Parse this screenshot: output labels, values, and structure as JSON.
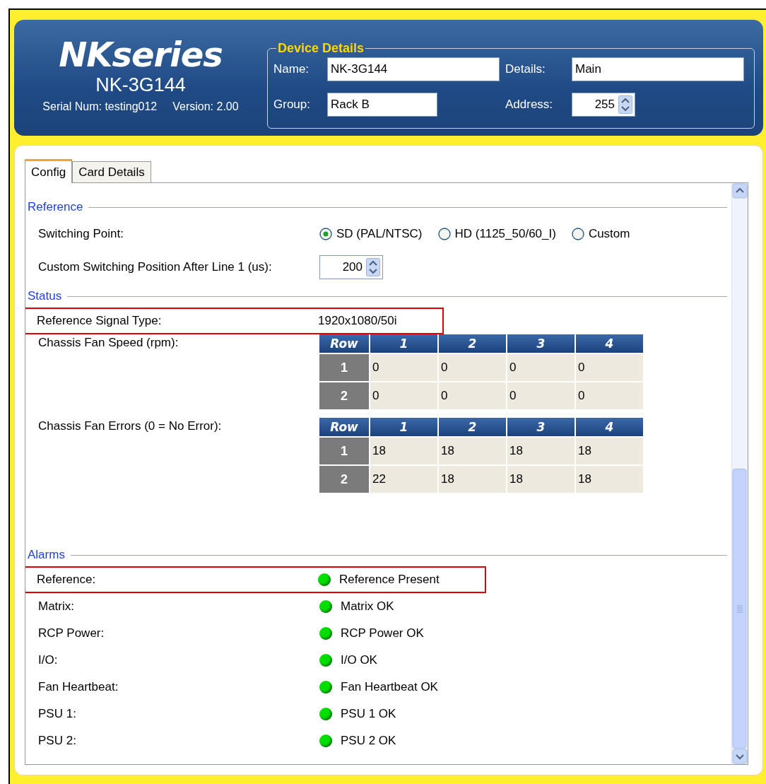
{
  "brand": {
    "logo": "NKseries",
    "model": "NK-3G144",
    "serial": "Serial Num: testing012",
    "version": "Version: 2.00"
  },
  "device_details": {
    "title": "Device Details",
    "fields": [
      {
        "label": "Name:",
        "value": "NK-3G144",
        "kind": "text"
      },
      {
        "label": "Details:",
        "value": "Main",
        "kind": "text"
      },
      {
        "label": "Group:",
        "value": "Rack B",
        "kind": "text"
      },
      {
        "label": "Address:",
        "value": "255",
        "kind": "spinner"
      }
    ]
  },
  "tabs": [
    {
      "label": "Config",
      "selected": true
    },
    {
      "label": "Card Details",
      "selected": false
    }
  ],
  "reference": {
    "heading": "Reference",
    "switching_point": {
      "label": "Switching Point:",
      "options": [
        {
          "label": "SD (PAL/NTSC)",
          "selected": true
        },
        {
          "label": "HD (1125_50/60_I)",
          "selected": false
        },
        {
          "label": "Custom",
          "selected": false
        }
      ]
    },
    "custom_position": {
      "label": "Custom Switching Position After Line 1 (us):",
      "value": "200"
    }
  },
  "status": {
    "heading": "Status",
    "signal_type": {
      "label": "Reference Signal Type:",
      "value": "1920x1080/50i",
      "highlighted": true
    },
    "tables": [
      {
        "label": "Chassis Fan Speed (rpm):",
        "columns": [
          "Row",
          "1",
          "2",
          "3",
          "4"
        ],
        "rows": [
          [
            "1",
            "0",
            "0",
            "0",
            "0"
          ],
          [
            "2",
            "0",
            "0",
            "0",
            "0"
          ]
        ]
      },
      {
        "label": "Chassis Fan Errors (0 = No Error):",
        "columns": [
          "Row",
          "1",
          "2",
          "3",
          "4"
        ],
        "rows": [
          [
            "1",
            "18",
            "18",
            "18",
            "18"
          ],
          [
            "2",
            "22",
            "18",
            "18",
            "18"
          ]
        ]
      }
    ]
  },
  "alarms": {
    "heading": "Alarms",
    "items": [
      {
        "label": "Reference:",
        "status": "Reference Present",
        "color": "#00e000",
        "highlighted": true
      },
      {
        "label": "Matrix:",
        "status": "Matrix OK",
        "color": "#00e000",
        "highlighted": false
      },
      {
        "label": "RCP Power:",
        "status": "RCP Power OK",
        "color": "#00e000",
        "highlighted": false
      },
      {
        "label": "I/O:",
        "status": "I/O OK",
        "color": "#00e000",
        "highlighted": false
      },
      {
        "label": "Fan Heartbeat:",
        "status": "Fan Heartbeat OK",
        "color": "#00e000",
        "highlighted": false
      },
      {
        "label": "PSU 1:",
        "status": "PSU 1 OK",
        "color": "#00e000",
        "highlighted": false
      },
      {
        "label": "PSU 2:",
        "status": "PSU 2 OK",
        "color": "#00e000",
        "highlighted": false
      }
    ]
  }
}
